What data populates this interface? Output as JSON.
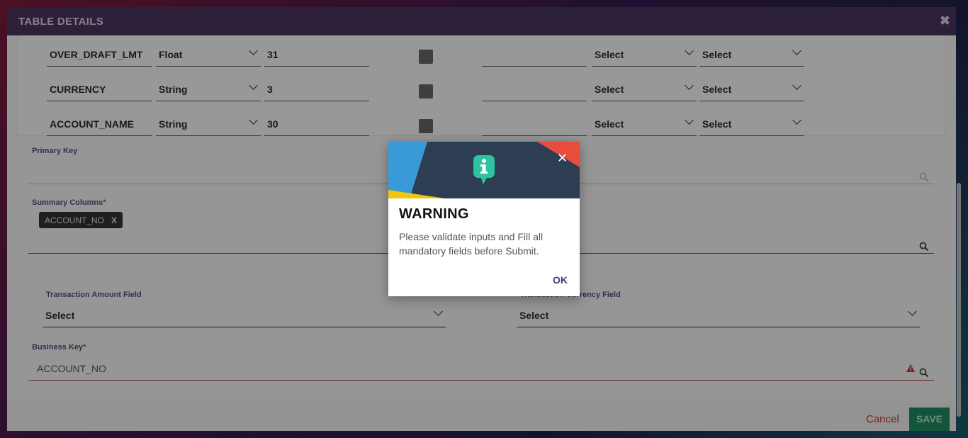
{
  "modal": {
    "title": "TABLE DETAILS",
    "rows": [
      {
        "name": "OVER_DRAFT_LMT",
        "type": "Float",
        "length": "31",
        "sel1": "Select",
        "sel2": "Select"
      },
      {
        "name": "CURRENCY",
        "type": "String",
        "length": "3",
        "sel1": "Select",
        "sel2": "Select"
      },
      {
        "name": "ACCOUNT_NAME",
        "type": "String",
        "length": "30",
        "sel1": "Select",
        "sel2": "Select"
      }
    ],
    "primary_key_label": "Primary Key",
    "summary_columns_label": "Summary Columns",
    "summary_chip": "ACCOUNT_NO",
    "chip_remove": "X",
    "txn_amount_label": "Transaction Amount Field",
    "txn_amount_value": "Select",
    "txn_currency_label": "Transaction Currency Field",
    "txn_currency_value": "Select",
    "business_key_label": "Business Key",
    "business_key_value": "ACCOUNT_NO",
    "required_mark": "*",
    "cancel_label": "Cancel",
    "save_label": "SAVE"
  },
  "dialog": {
    "title": "WARNING",
    "message": "Please validate inputs and Fill all mandatory fields before Submit.",
    "ok_label": "OK",
    "icon": "info-bubble-icon"
  },
  "colors": {
    "header": "#4a3560",
    "save": "#1e8a5f",
    "cancel": "#c0392b",
    "banner_dark": "#2e3e52",
    "banner_blue": "#3a9ad9",
    "banner_red": "#e74c3c",
    "banner_yellow": "#f1c40f",
    "icon_teal": "#2ec4a0"
  }
}
